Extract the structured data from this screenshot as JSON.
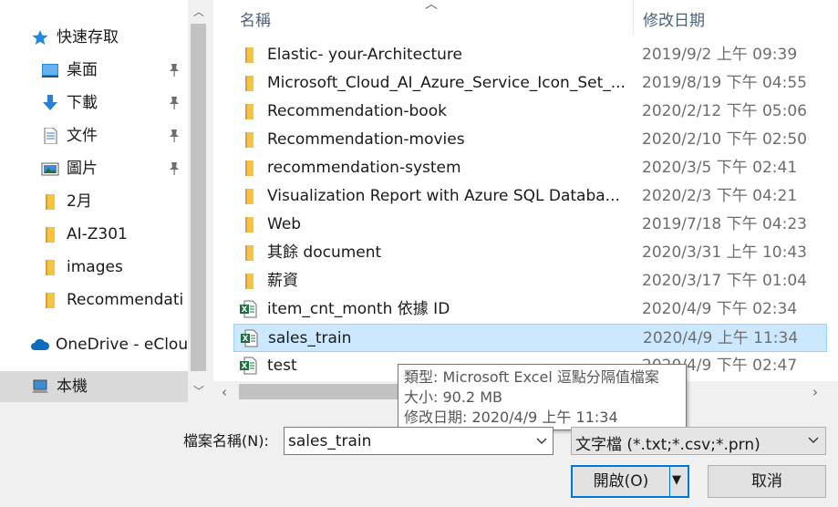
{
  "nav": {
    "items": [
      {
        "label": "快速存取",
        "icon": "star-icon",
        "pinned": false
      },
      {
        "label": "桌面",
        "icon": "desktop-icon",
        "pinned": true
      },
      {
        "label": "下載",
        "icon": "download-arrow-icon",
        "pinned": true
      },
      {
        "label": "文件",
        "icon": "document-icon",
        "pinned": true
      },
      {
        "label": "圖片",
        "icon": "pictures-icon",
        "pinned": true
      },
      {
        "label": "2月",
        "icon": "folder-icon",
        "pinned": false
      },
      {
        "label": "AI-Z301",
        "icon": "folder-icon",
        "pinned": false
      },
      {
        "label": "images",
        "icon": "folder-icon",
        "pinned": false
      },
      {
        "label": "Recommendati",
        "icon": "folder-icon",
        "pinned": false
      },
      {
        "label": "OneDrive - eClou",
        "icon": "cloud-icon",
        "pinned": false
      },
      {
        "label": "本機",
        "icon": "computer-icon",
        "pinned": false,
        "selected": true
      }
    ]
  },
  "list": {
    "header": {
      "name": "名稱",
      "date": "修改日期"
    },
    "rows": [
      {
        "name": "Elastic- your-Architecture",
        "date": "2019/9/2 上午 09:39",
        "type": "folder"
      },
      {
        "name": "Microsoft_Cloud_AI_Azure_Service_Icon_Set_...",
        "date": "2019/8/19 下午 04:55",
        "type": "folder"
      },
      {
        "name": "Recommendation-book",
        "date": "2020/2/12 下午 05:06",
        "type": "folder"
      },
      {
        "name": "Recommendation-movies",
        "date": "2020/2/10 下午 02:50",
        "type": "folder"
      },
      {
        "name": "recommendation-system",
        "date": "2020/3/5 下午 02:41",
        "type": "folder"
      },
      {
        "name": "Visualization Report with Azure SQL Databa...",
        "date": "2020/2/3 下午 04:21",
        "type": "folder"
      },
      {
        "name": "Web",
        "date": "2019/7/18 下午 04:23",
        "type": "folder"
      },
      {
        "name": "其餘 document",
        "date": "2020/3/31 上午 10:43",
        "type": "folder"
      },
      {
        "name": "薪資",
        "date": "2020/3/17 下午 01:04",
        "type": "folder"
      },
      {
        "name": "item_cnt_month 依據 ID",
        "date": "2020/4/9 下午 02:34",
        "type": "excel"
      },
      {
        "name": "sales_train",
        "date": "2020/4/9 上午 11:34",
        "type": "excel",
        "selected": true
      },
      {
        "name": "test",
        "date": "2020/4/9 下午 02:47",
        "type": "excel"
      }
    ]
  },
  "tooltip": {
    "type_line": "類型: Microsoft Excel 逗點分隔值檔案",
    "size_line": "大小: 90.2 MB",
    "date_line": "修改日期: 2020/4/9 上午 11:34"
  },
  "footer": {
    "filename_label": "檔案名稱(N):",
    "filename_value": "sales_train",
    "filetype_value": "文字檔 (*.txt;*.csv;*.prn)",
    "open_label": "開啟(O)",
    "cancel_label": "取消"
  },
  "colors": {
    "selection_bg": "#cce8ff",
    "accent": "#0078d7",
    "folder": "#f6c445",
    "excel": "#1d6f42"
  }
}
